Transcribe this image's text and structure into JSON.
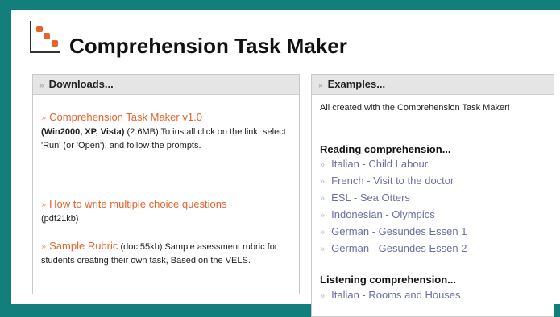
{
  "header": {
    "title": "Comprehension Task Maker"
  },
  "downloads": {
    "heading": "Downloads...",
    "items": [
      {
        "link": "Comprehension Task Maker v1.0",
        "bold": "(Win2000, XP, Vista)",
        "desc": " (2.6MB) To install click on the link, select 'Run' (or 'Open'), and follow the prompts."
      },
      {
        "link": "How to write multiple choice questions",
        "desc": "(pdf21kb)"
      },
      {
        "link": "Sample Rubric",
        "desc": " (doc 55kb) Sample asessment rubric for students creating their own task, Based on the VELS."
      }
    ]
  },
  "examples": {
    "heading": "Examples...",
    "intro": "All created with the Comprehension Task Maker!",
    "reading_heading": "Reading comprehension...",
    "reading": [
      "Italian - Child Labour",
      "French - Visit to the doctor",
      "ESL - Sea Otters",
      "Indonesian - Olympics",
      "German - Gesundes Essen 1",
      "German - Gesundes Essen 2"
    ],
    "listening_heading": "Listening comprehension...",
    "listening": [
      "Italian - Rooms and Houses"
    ]
  },
  "icons": {
    "logo": "dots-logo-icon",
    "bullet": "double-chevron-right-icon"
  },
  "colors": {
    "frame": "#127f7c",
    "download_link": "#e8632a",
    "example_link": "#6c6fa5"
  }
}
